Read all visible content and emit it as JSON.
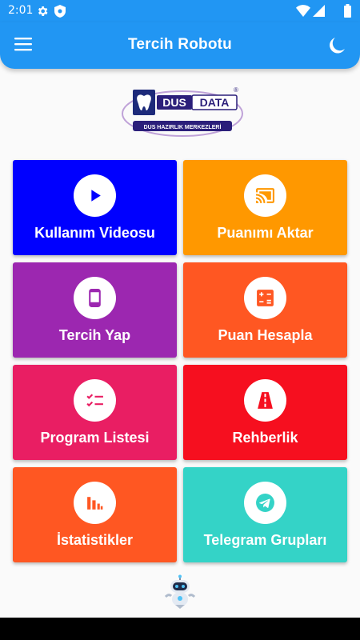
{
  "status_bar": {
    "time": "2:01",
    "icons": [
      "gear-icon",
      "shield-icon",
      "wifi-icon",
      "signal-icon",
      "battery-icon"
    ]
  },
  "app_bar": {
    "title": "Tercih Robotu",
    "menu_icon": "hamburger-menu-icon",
    "theme_icon": "dark-mode-moon-icon",
    "color": "#2196f3"
  },
  "logo": {
    "brand_left": "DUS",
    "brand_right": "DATA",
    "subtitle": "DUS HAZIRLIK MERKEZLERİ",
    "registered": "®"
  },
  "tiles": [
    {
      "label": "Kullanım Videosu",
      "icon": "play-icon",
      "color": "#0000ff"
    },
    {
      "label": "Puanımı Aktar",
      "icon": "cast-icon",
      "color": "#ff9800"
    },
    {
      "label": "Tercih Yap",
      "icon": "phone-icon",
      "color": "#9c27b0"
    },
    {
      "label": "Puan Hesapla",
      "icon": "calculator-icon",
      "color": "#ff5722"
    },
    {
      "label": "Program Listesi",
      "icon": "checklist-icon",
      "color": "#e91e63"
    },
    {
      "label": "Rehberlik",
      "icon": "road-icon",
      "color": "#f60f1f"
    },
    {
      "label": "İstatistikler",
      "icon": "bar-chart-icon",
      "color": "#ff5722"
    },
    {
      "label": "Telegram Grupları",
      "icon": "telegram-icon",
      "color": "#34d3c7"
    }
  ]
}
